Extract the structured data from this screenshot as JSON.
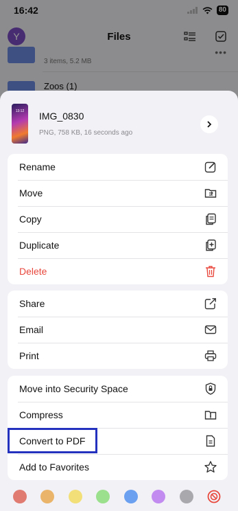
{
  "status": {
    "time": "16:42",
    "battery": "80"
  },
  "nav": {
    "avatar_letter": "Y",
    "title": "Files"
  },
  "files": [
    {
      "meta": "3 items, 5.2 MB"
    },
    {
      "name": "Zoos (1)"
    }
  ],
  "sheet": {
    "doc_title": "IMG_0830",
    "doc_subtitle": "PNG, 758 KB, 16 seconds ago",
    "thumb_time": "13:12",
    "groups": [
      [
        {
          "label": "Rename",
          "icon": "rename-icon"
        },
        {
          "label": "Move",
          "icon": "move-folder-icon"
        },
        {
          "label": "Copy",
          "icon": "copy-icon"
        },
        {
          "label": "Duplicate",
          "icon": "duplicate-icon"
        },
        {
          "label": "Delete",
          "icon": "trash-icon",
          "color": "#e8473c"
        }
      ],
      [
        {
          "label": "Share",
          "icon": "share-icon"
        },
        {
          "label": "Email",
          "icon": "mail-icon"
        },
        {
          "label": "Print",
          "icon": "printer-icon"
        }
      ],
      [
        {
          "label": "Move into Security Space",
          "icon": "shield-lock-icon"
        },
        {
          "label": "Compress",
          "icon": "zip-folder-icon"
        },
        {
          "label": "Convert to PDF",
          "icon": "document-icon"
        },
        {
          "label": "Add to Favorites",
          "icon": "star-icon"
        }
      ]
    ],
    "color_tags": [
      "#e07b72",
      "#eab46a",
      "#f2df78",
      "#9be08c",
      "#6b9ff0",
      "#c18bef",
      "#a9a9ad"
    ],
    "no_tag_color": "#e8473c",
    "highlight_color": "#2431bf"
  }
}
